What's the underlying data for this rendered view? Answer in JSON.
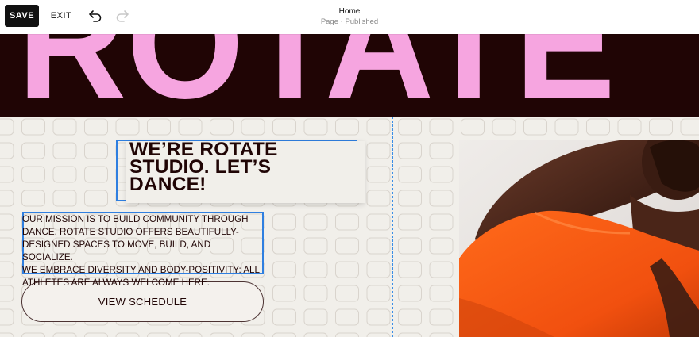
{
  "toolbar": {
    "save_label": "SAVE",
    "exit_label": "EXIT",
    "undo_icon": "undo-icon",
    "redo_icon": "redo-icon"
  },
  "document": {
    "title": "Home",
    "status": "Page · Published"
  },
  "banner": {
    "word": "ROTATE",
    "background_color": "#200505",
    "text_color": "#f6a5e0"
  },
  "content": {
    "heading": "WE’RE ROTATE\nSTUDIO. LET’S\nDANCE!",
    "mission": "OUR MISSION IS TO BUILD COMMUNITY THROUGH\nDANCE. ROTATE STUDIO OFFERS BEAUTIFULLY-\nDESIGNED SPACES TO MOVE, BUILD, AND SOCIALIZE.\nWE EMBRACE DIVERSITY AND BODY-POSITIVITY: ALL\nATHLETES ARE ALWAYS WELCOME HERE.",
    "cta_label": "VIEW SCHEDULE"
  },
  "colors": {
    "selection_outline": "#2f7fe0",
    "page_background": "#f1efea",
    "text_dark": "#200505",
    "shirt_orange": "#ff5a14"
  }
}
